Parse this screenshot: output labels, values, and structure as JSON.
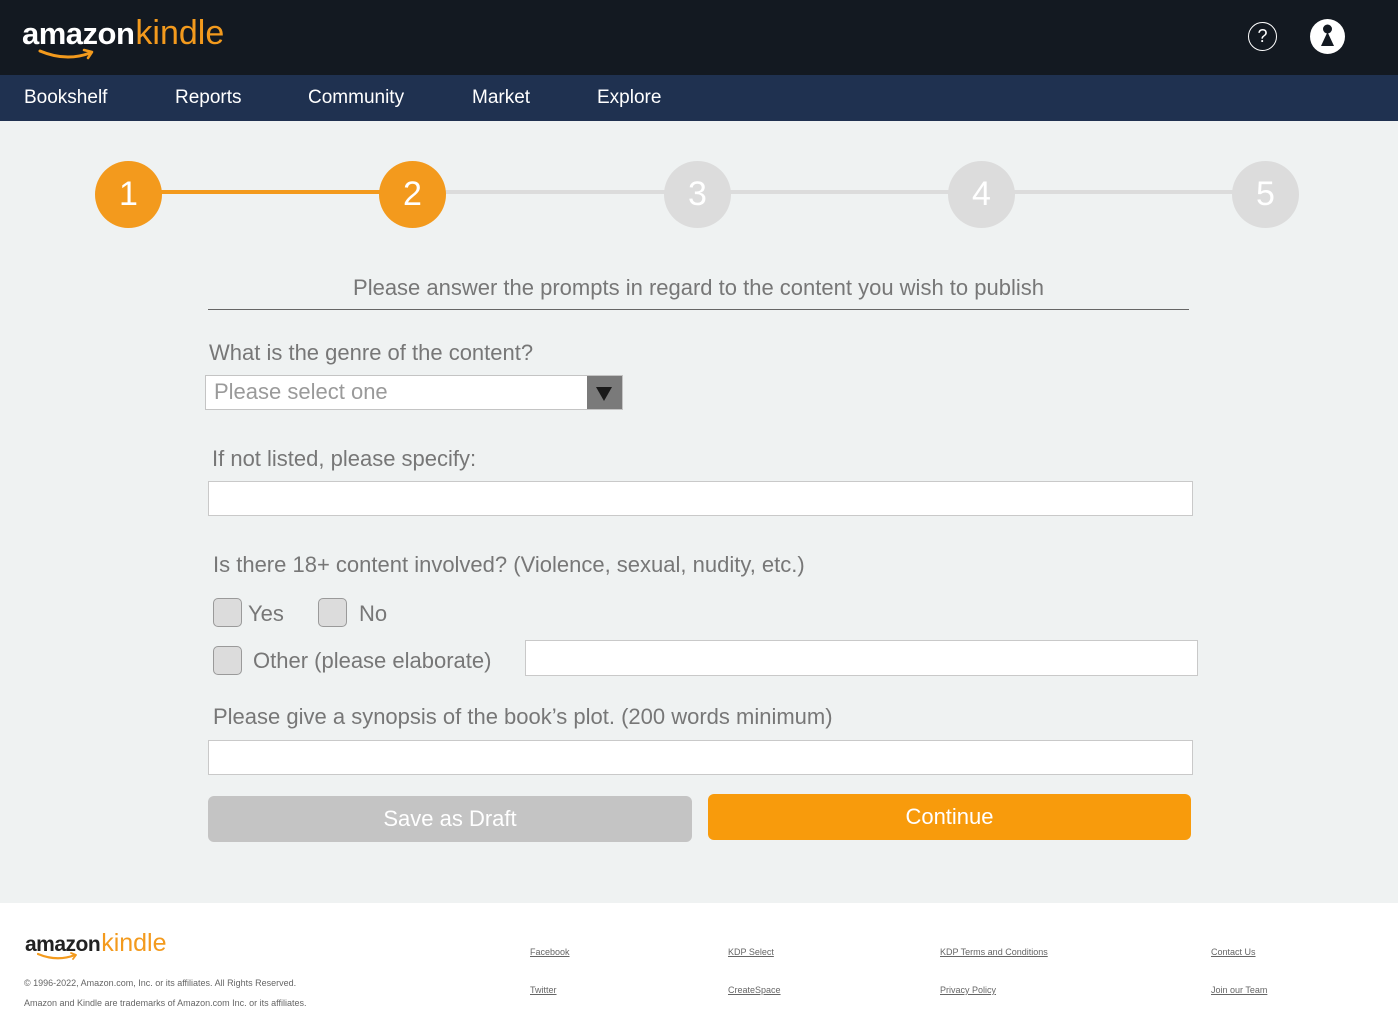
{
  "header": {
    "logo_amazon": "amazon",
    "logo_kindle": "kindle",
    "help_icon": "question-mark-icon",
    "help_symbol": "?",
    "profile_icon": "user-profile-icon"
  },
  "nav": {
    "items": [
      {
        "label": "Bookshelf"
      },
      {
        "label": "Reports"
      },
      {
        "label": "Community"
      },
      {
        "label": "Market"
      },
      {
        "label": "Explore"
      }
    ]
  },
  "stepper": {
    "current_step": 2,
    "total_steps": 5,
    "steps": [
      {
        "label": "1",
        "state": "active"
      },
      {
        "label": "2",
        "state": "active"
      },
      {
        "label": "3",
        "state": "inactive"
      },
      {
        "label": "4",
        "state": "inactive"
      },
      {
        "label": "5",
        "state": "inactive"
      }
    ]
  },
  "form": {
    "heading": "Please answer the prompts in regard to the content you wish to publish",
    "genre_label": "What is the genre of the content?",
    "genre_select_value": "Please select one",
    "specify_label": "If not listed, please specify:",
    "specify_value": "",
    "adult_label": "Is there 18+ content involved? (Violence, sexual, nudity, etc.)",
    "option_yes": "Yes",
    "option_no": "No",
    "option_other": "Other (please elaborate)",
    "other_value": "",
    "synopsis_label": "Please give a synopsis of the book’s plot. (200 words minimum)",
    "synopsis_value": "",
    "save_draft_label": "Save as Draft",
    "continue_label": "Continue"
  },
  "footer": {
    "logo_amazon": "amazon",
    "logo_kindle": "kindle",
    "copyright_1": "© 1996-2022, Amazon.com, Inc. or its affiliates. All Rights Reserved.",
    "copyright_2": "Amazon and Kindle are trademarks of Amazon.com Inc. or its affiliates.",
    "links": {
      "facebook": "Facebook",
      "twitter": "Twitter",
      "kdp_select": "KDP Select",
      "createspace": "CreateSpace",
      "kdp_terms": "KDP Terms and Conditions",
      "privacy": "Privacy Policy",
      "contact": "Contact Us",
      "join": "Join our Team"
    }
  },
  "colors": {
    "header_bg": "#131921",
    "nav_bg": "#1f3150",
    "accent": "#f39a1d",
    "continue_bg": "#f89b0c",
    "inactive_step": "#dcdcdc",
    "page_bg": "#eff2f2"
  }
}
